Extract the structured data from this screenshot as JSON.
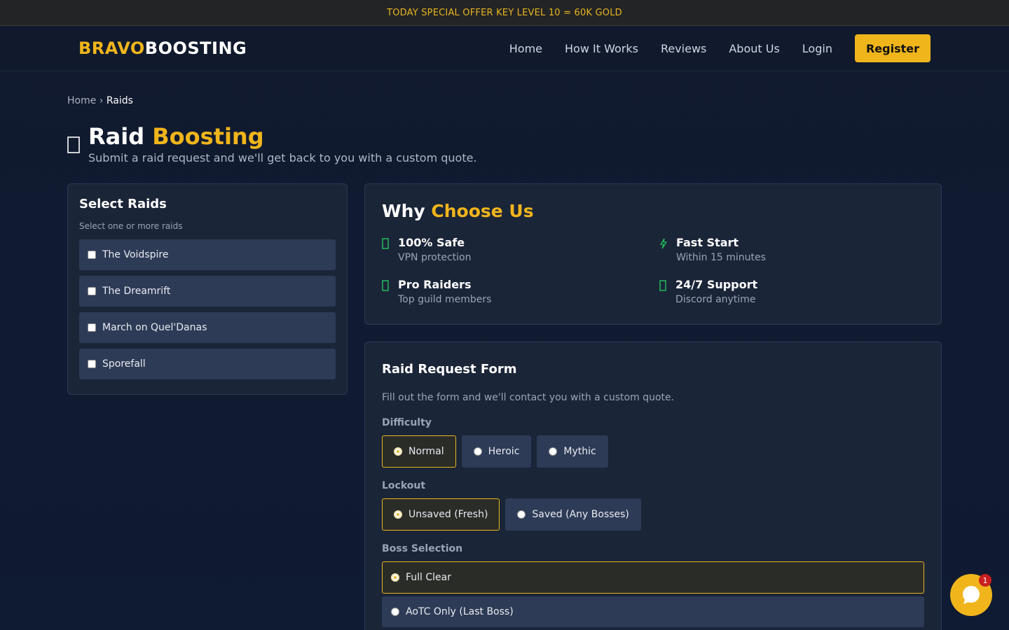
{
  "promo": {
    "text": "TODAY SPECIAL OFFER KEY LEVEL 10 = 60K GOLD"
  },
  "nav": {
    "logo_a": "BRAVO",
    "logo_b": "BOOSTING",
    "links": [
      "Home",
      "How It Works",
      "Reviews",
      "About Us",
      "Login"
    ],
    "register": "Register"
  },
  "breadcrumb": {
    "home": "Home",
    "sep": "›",
    "current": "Raids"
  },
  "hero": {
    "icon": "sword-icon",
    "title_a": "Raid",
    "title_b": "Boosting",
    "subtitle": "Submit a raid request and we'll get back to you with a custom quote."
  },
  "raids": {
    "title": "Select Raids",
    "subtitle": "Select one or more raids",
    "items": [
      "The Voidspire",
      "The Dreamrift",
      "March on Quel'Danas",
      "Sporefall"
    ]
  },
  "why": {
    "title_a": "Why",
    "title_b": "Choose Us",
    "features": [
      {
        "title": "100% Safe",
        "desc": "VPN protection",
        "icon": "shield-icon"
      },
      {
        "title": "Fast Start",
        "desc": "Within 15 minutes",
        "icon": "lightning-icon"
      },
      {
        "title": "Pro Raiders",
        "desc": "Top guild members",
        "icon": "trophy-icon"
      },
      {
        "title": "24/7 Support",
        "desc": "Discord anytime",
        "icon": "chat-icon"
      }
    ]
  },
  "form": {
    "title": "Raid Request Form",
    "subtitle": "Fill out the form and we'll contact you with a custom quote.",
    "difficulty_label": "Difficulty",
    "difficulty": [
      "Normal",
      "Heroic",
      "Mythic"
    ],
    "difficulty_selected": "Normal",
    "lockout_label": "Lockout",
    "lockout": [
      "Unsaved (Fresh)",
      "Saved (Any Bosses)"
    ],
    "lockout_selected": "Unsaved (Fresh)",
    "boss_label": "Boss Selection",
    "boss": [
      "Full Clear",
      "AoTC Only (Last Boss)"
    ],
    "boss_selected": "Full Clear"
  },
  "chat": {
    "badge": "1"
  },
  "colors": {
    "accent": "#f0b51b",
    "background": "#111a2e",
    "card": "#1b2538",
    "option": "#2e3b56",
    "success": "#22c55e"
  }
}
